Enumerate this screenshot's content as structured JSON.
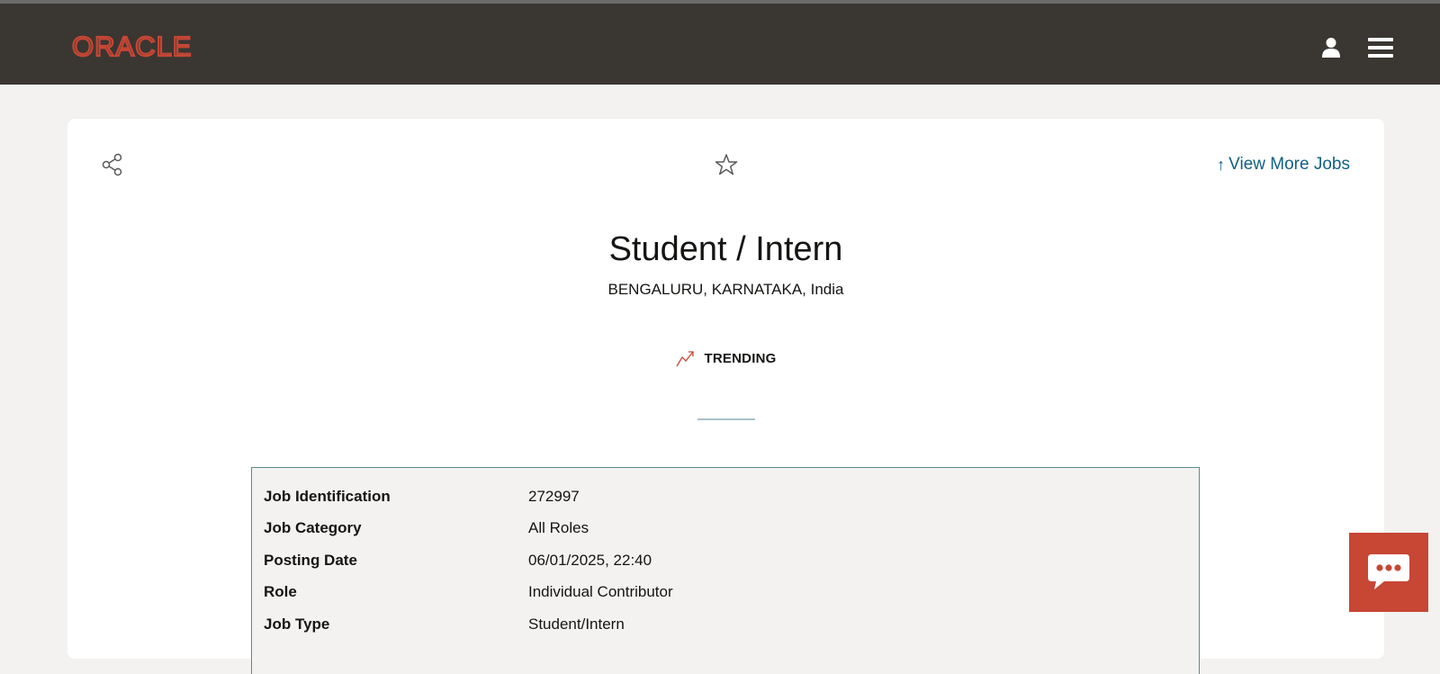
{
  "header": {
    "logo_text": "ORACLE",
    "brand_color": "#c74634",
    "background": "#3a3632",
    "user_icon": "user-icon",
    "menu_icon": "hamburger-menu-icon"
  },
  "toolbar": {
    "share_icon": "share-icon",
    "favorite_icon": "star-icon",
    "view_more_arrow": "↑",
    "view_more_label": "View More Jobs"
  },
  "job": {
    "title": "Student / Intern",
    "location": "BENGALURU, KARNATAKA, India",
    "badge_label": "TRENDING",
    "badge_icon": "trending-up-icon"
  },
  "details": [
    {
      "label": "Job Identification",
      "value": "272997"
    },
    {
      "label": "Job Category",
      "value": "All Roles"
    },
    {
      "label": "Posting Date",
      "value": "06/01/2025, 22:40"
    },
    {
      "label": "Role",
      "value": "Individual Contributor"
    },
    {
      "label": "Job Type",
      "value": "Student/Intern"
    }
  ],
  "chat": {
    "icon": "chat-bubble-icon",
    "color": "#c74634"
  }
}
